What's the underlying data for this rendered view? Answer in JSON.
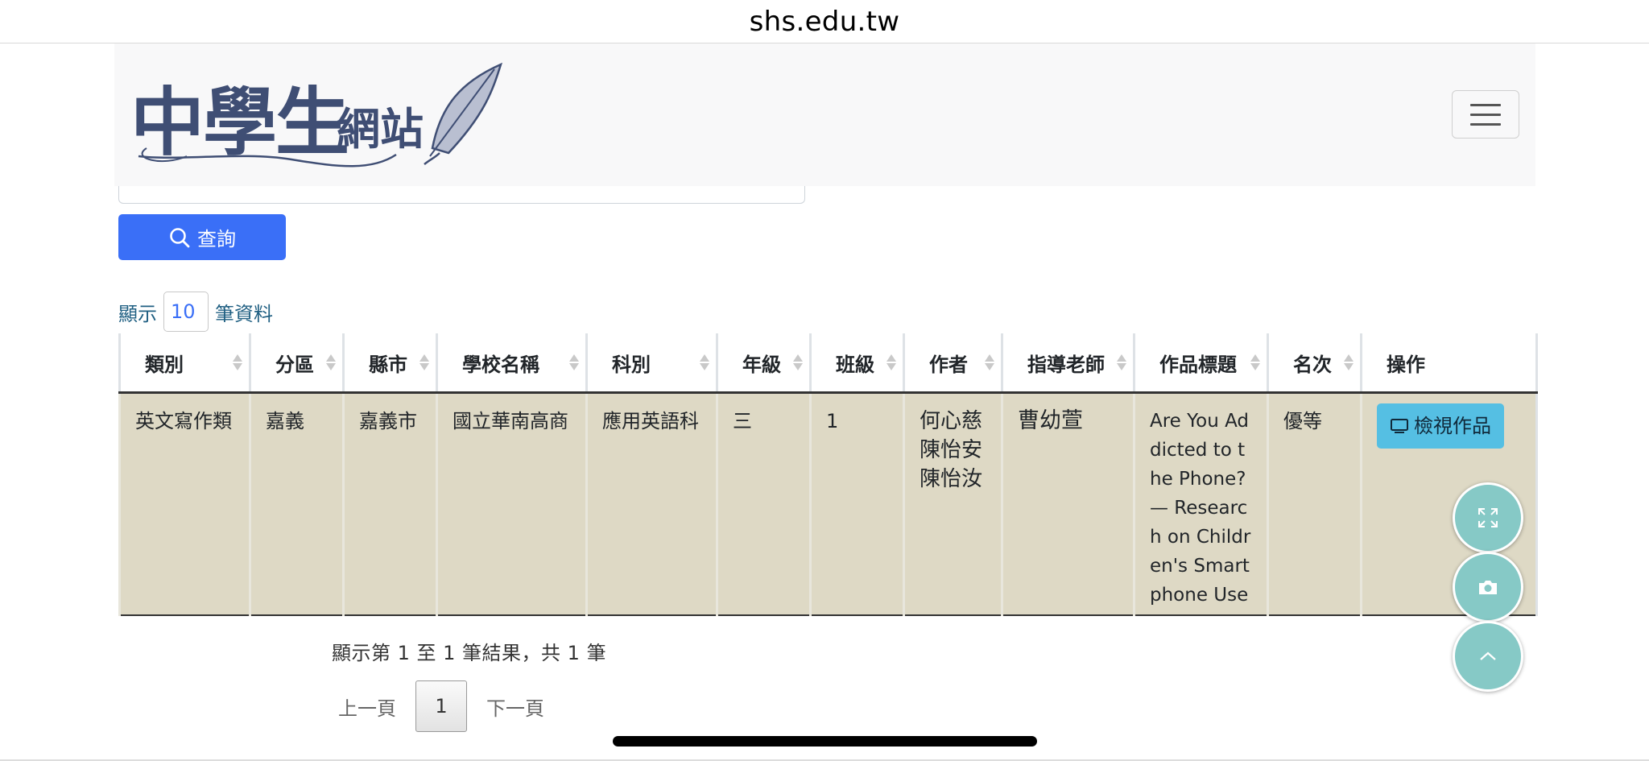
{
  "browser": {
    "url": "shs.edu.tw"
  },
  "header": {
    "logo_text": "中學生",
    "logo_sub": "網站",
    "menu_icon": "hamburger-icon"
  },
  "search": {
    "query_button": "查詢",
    "query_icon": "search-icon"
  },
  "length": {
    "prefix": "顯示",
    "value": "10",
    "suffix": "筆資料"
  },
  "table": {
    "columns": [
      "類別",
      "分區",
      "縣市",
      "學校名稱",
      "科別",
      "年級",
      "班級",
      "作者",
      "指導老師",
      "作品標題",
      "名次",
      "操作"
    ],
    "rows": [
      {
        "category": "英文寫作類",
        "district": "嘉義",
        "city": "嘉義市",
        "school": "國立華南高商",
        "department": "應用英語科",
        "grade": "三",
        "class": "1",
        "authors": [
          "何心慈",
          "陳怡安",
          "陳怡汝"
        ],
        "teacher": "曹幼萱",
        "title": "Are You Addicted to the Phone? — Research on Children's Smartphone Use",
        "rank": "優等",
        "action": "檢視作品"
      }
    ]
  },
  "info": "顯示第 1 至 1 筆結果，共 1 筆",
  "pagination": {
    "prev": "上一頁",
    "current": "1",
    "next": "下一頁"
  },
  "fabs": [
    "fullscreen-icon",
    "camera-icon",
    "chevron-up-icon"
  ],
  "colors": {
    "primary_button": "#3a6ff7",
    "info_button": "#55bfe3",
    "row_highlight": "#ded9c5",
    "fab": "#86c9c6",
    "logo": "#3f4e74"
  }
}
